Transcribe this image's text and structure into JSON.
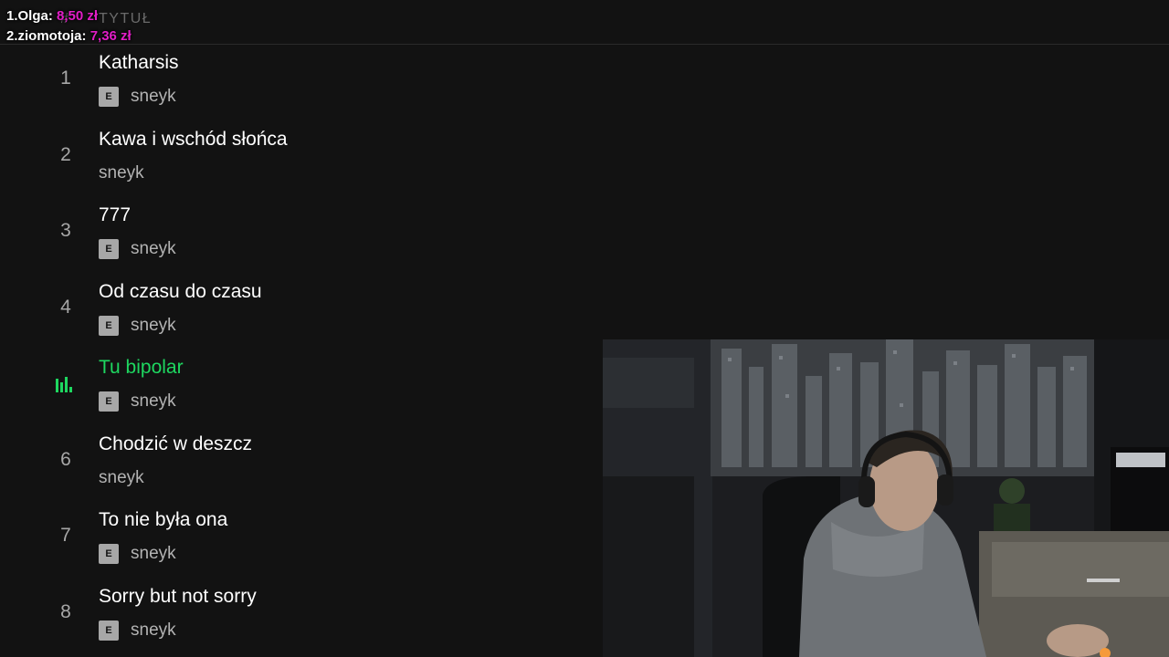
{
  "donations": [
    {
      "rank": "1.",
      "name": "Olga:",
      "amount": "8,50 zł"
    },
    {
      "rank": "2.",
      "name": "ziomotoja:",
      "amount": "7,36 zł"
    }
  ],
  "header": {
    "hash": "#",
    "title": "TYTUŁ"
  },
  "tracks": [
    {
      "number": "1",
      "title": "Katharsis",
      "explicit": true,
      "explicit_badge": "E",
      "artist": "sneyk",
      "playing": false
    },
    {
      "number": "2",
      "title": "Kawa i wschód słońca",
      "explicit": false,
      "artist": "sneyk",
      "playing": false
    },
    {
      "number": "3",
      "title": "777",
      "explicit": true,
      "explicit_badge": "E",
      "artist": "sneyk",
      "playing": false
    },
    {
      "number": "4",
      "title": "Od czasu do czasu",
      "explicit": true,
      "explicit_badge": "E",
      "artist": "sneyk",
      "playing": false
    },
    {
      "number": "5",
      "title": "Tu bipolar",
      "explicit": true,
      "explicit_badge": "E",
      "artist": "sneyk",
      "playing": true,
      "indicator_icon": "equalizer-icon"
    },
    {
      "number": "6",
      "title": "Chodzić w deszcz",
      "explicit": false,
      "artist": "sneyk",
      "playing": false
    },
    {
      "number": "7",
      "title": "To nie była ona",
      "explicit": true,
      "explicit_badge": "E",
      "artist": "sneyk",
      "playing": false
    },
    {
      "number": "8",
      "title": "Sorry but not sorry",
      "explicit": true,
      "explicit_badge": "E",
      "artist": "sneyk",
      "playing": false
    }
  ],
  "colors": {
    "background": "#121212",
    "playing": "#1ed760",
    "donation_amount": "#e21ec7"
  }
}
